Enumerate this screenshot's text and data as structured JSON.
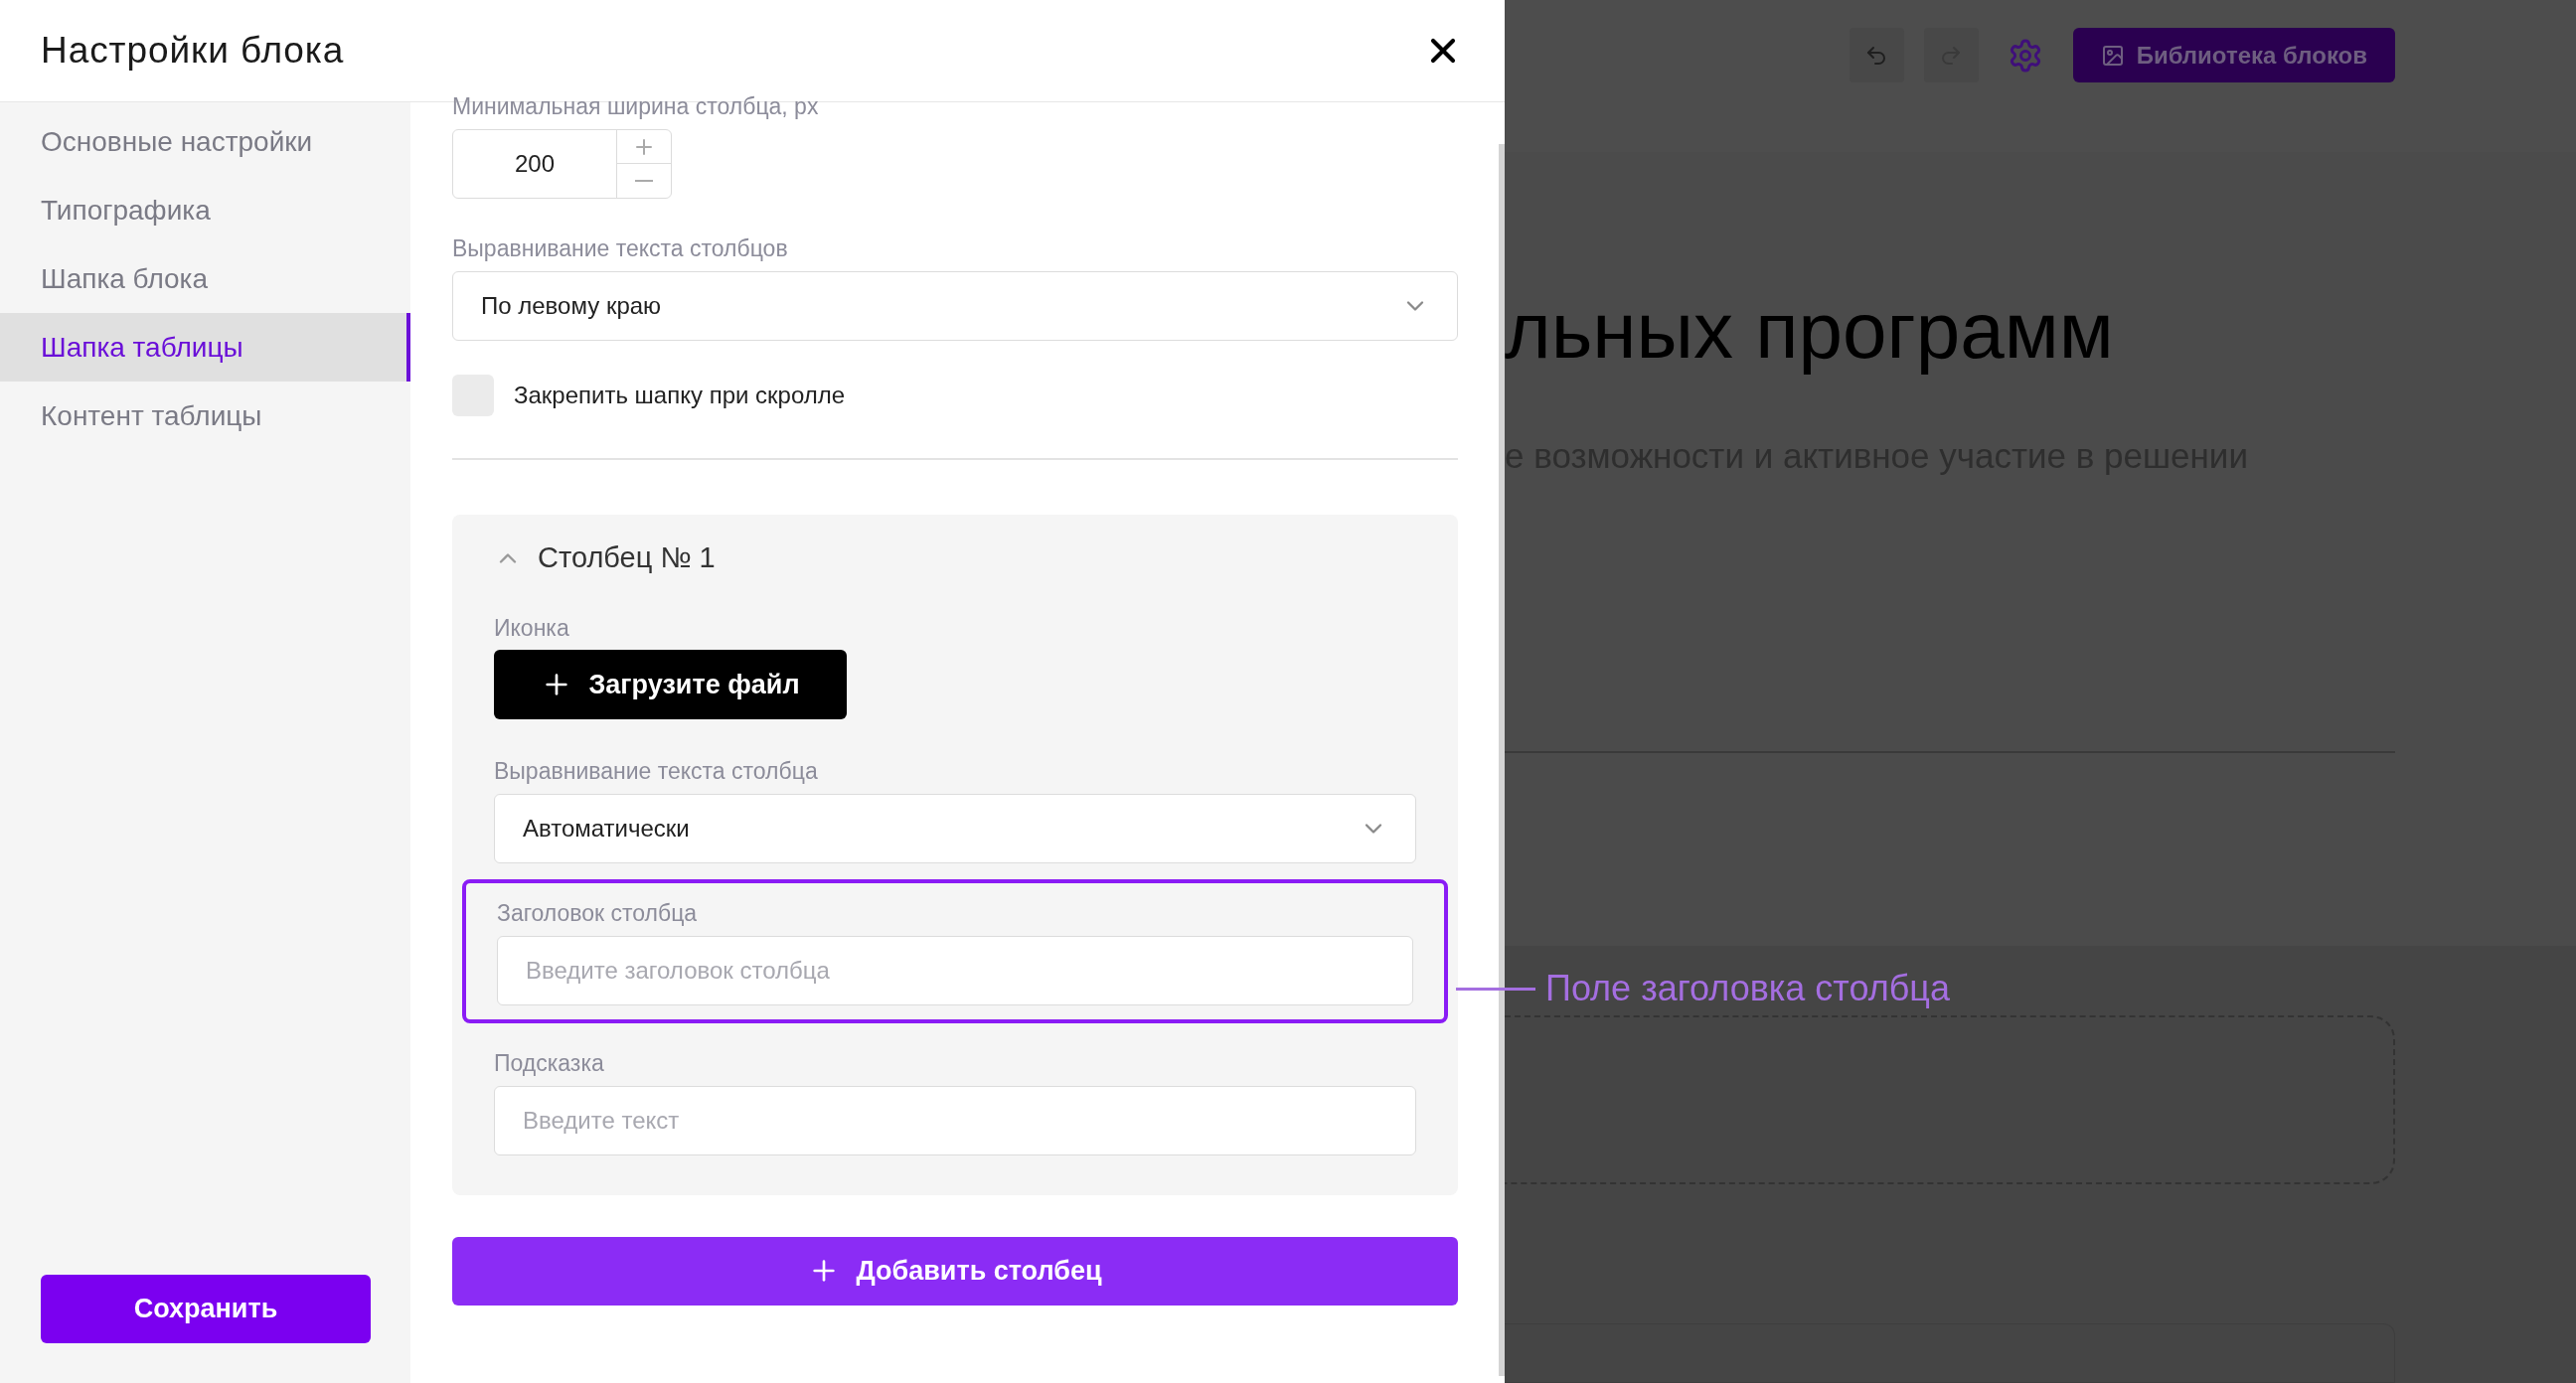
{
  "drawer": {
    "title": "Настройки блока",
    "sidebar": [
      {
        "label": "Основные настройки",
        "selected": false
      },
      {
        "label": "Типографика",
        "selected": false
      },
      {
        "label": "Шапка блока",
        "selected": false
      },
      {
        "label": "Шапка таблицы",
        "selected": true
      },
      {
        "label": "Контент таблицы",
        "selected": false
      }
    ],
    "save_button": "Сохранить",
    "min_width": {
      "label": "Минимальная ширина столбца, px",
      "value": "200"
    },
    "columns_align": {
      "label": "Выравнивание текста столбцов",
      "value": "По левому краю"
    },
    "sticky_header": {
      "label": "Закрепить шапку при скролле",
      "checked": false
    },
    "column": {
      "title": "Столбец № 1",
      "expanded": true,
      "icon_label": "Иконка",
      "upload_button": "Загрузите файл",
      "align": {
        "label": "Выравнивание текста столбца",
        "value": "Автоматически"
      },
      "header": {
        "label": "Заголовок столбца",
        "placeholder": "Введите заголовок столбца",
        "highlighted": true
      },
      "hint": {
        "label": "Подсказка",
        "placeholder": "Введите текст"
      }
    },
    "add_column_button": "Добавить столбец"
  },
  "background_page": {
    "library_button": "Библиотека блоков",
    "heading": "льных программ",
    "subtitle": "е возможности и активное участие в решении"
  },
  "annotation": {
    "text": "Поле заголовка столбца"
  }
}
